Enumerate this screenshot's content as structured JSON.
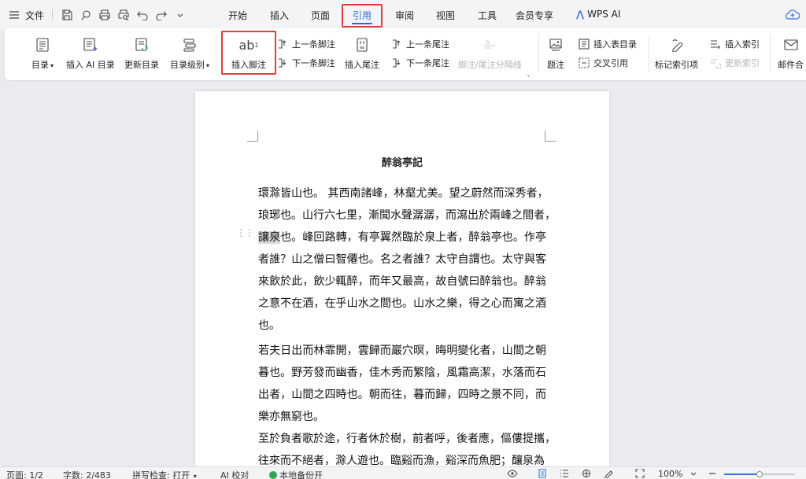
{
  "menubar": {
    "file_label": "文件",
    "tabs": [
      "开始",
      "插入",
      "页面",
      "引用",
      "审阅",
      "视图",
      "工具",
      "会员专享"
    ],
    "active_tab": "引用",
    "wps_ai": "WPS AI"
  },
  "ribbon": {
    "toc": "目录",
    "insert_ai_toc": "插入 AI 目录",
    "update_toc": "更新目录",
    "toc_level": "目录级别",
    "insert_footnote": "插入脚注",
    "prev_footnote": "上一条脚注",
    "next_footnote": "下一条脚注",
    "insert_endnote": "插入尾注",
    "prev_endnote": "上一条尾注",
    "next_endnote": "下一条尾注",
    "note_separator": "脚注/尾注分隔线",
    "caption": "题注",
    "insert_table_of_figures": "插入表目录",
    "cross_reference": "交叉引用",
    "mark_index_entry": "标记索引项",
    "insert_index": "插入索引",
    "update_index": "更新索引",
    "mail_merge": "邮件合",
    "footnote_icon_text": "ab"
  },
  "document": {
    "title": "醉翁亭記",
    "paragraphs": [
      {
        "lines": [
          "環滁皆山也。 其西南諸峰，林壑尤美。望之蔚然而深秀者，",
          "琅琊也。山行六七里，漸聞水聲潺潺，而瀉出於兩峰之間者，",
          [
            "讓泉",
            "也。峰回路轉，有亭翼然臨於泉上者，醉翁亭也。作亭"
          ],
          "者誰？山之僧曰智僊也。名之者誰？太守自謂也。太守與客",
          "來飲於此，飲少輒醉，而年又最高，故自號曰醉翁也。醉翁",
          "之意不在酒，在乎山水之間也。山水之樂，得之心而寓之酒",
          "也。"
        ]
      },
      {
        "lines": [
          "若夫日出而林霏開，雲歸而巖穴暝，晦明變化者，山間之朝",
          "暮也。野芳發而幽香，佳木秀而繁陰，風霜高潔，水落而石",
          "出者，山間之四時也。朝而往，暮而歸，四時之景不同，而",
          "樂亦無窮也。"
        ]
      },
      {
        "lines": [
          "至於負者歌於途，行者休於樹，前者呼，後者應，傴僂提攜，",
          "往來而不絕者，滁人遊也。臨谿而漁，谿深而魚肥；釀泉為"
        ]
      }
    ]
  },
  "statusbar": {
    "page": "页面: 1/2",
    "word_count": "字数: 2/483",
    "spell_check": "拼写检查: 打开",
    "ai_proofread": "AI 校对",
    "backup": "本地备份开",
    "zoom": "100%",
    "zoom_level_fraction": 0.5
  },
  "colors": {
    "accent": "#2a6ad8",
    "highlight_box": "#e23b3b",
    "ai_purple": "#3c6df0",
    "status_green": "#2fa84f"
  }
}
